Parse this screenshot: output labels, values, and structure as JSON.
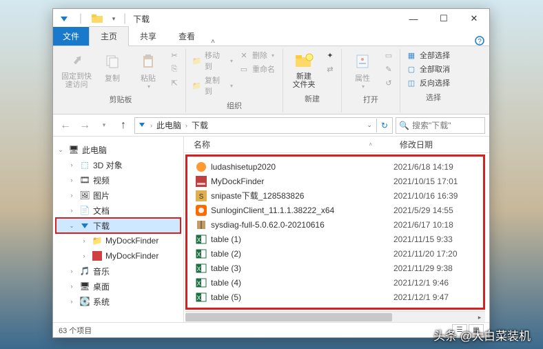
{
  "window": {
    "title": "下载",
    "min": "—",
    "max": "☐",
    "close": "✕"
  },
  "ribbonTabs": {
    "file": "文件",
    "home": "主页",
    "share": "共享",
    "view": "查看"
  },
  "ribbon": {
    "pin": "固定到快\n速访问",
    "copy": "复制",
    "paste": "粘贴",
    "clipboard_actions": {
      "cut": "",
      "copypath": "",
      "pasteshortcut": ""
    },
    "group_clipboard": "剪贴板",
    "moveto": "移动到",
    "copyto": "复制到",
    "delete": "删除",
    "rename": "重命名",
    "group_organize": "组织",
    "newfolder": "新建\n文件夹",
    "group_new": "新建",
    "properties": "属性",
    "group_open": "打开",
    "selectall": "全部选择",
    "selectnone": "全部取消",
    "invertsel": "反向选择",
    "group_select": "选择"
  },
  "address": {
    "pc": "此电脑",
    "folder": "下载",
    "search_placeholder": "搜索\"下载\""
  },
  "tree": {
    "thispc": "此电脑",
    "objects3d": "3D 对象",
    "videos": "视频",
    "pictures": "图片",
    "documents": "文档",
    "downloads": "下载",
    "mydock1": "MyDockFinder",
    "mydock2": "MyDockFinder",
    "music": "音乐",
    "desktop": "桌面",
    "system": "系统"
  },
  "columns": {
    "name": "名称",
    "date": "修改日期"
  },
  "files": [
    {
      "icon": "orange-setup",
      "name": "ludashisetup2020",
      "date": "2021/6/18 14:19"
    },
    {
      "icon": "dock",
      "name": "MyDockFinder",
      "date": "2021/10/15 17:01"
    },
    {
      "icon": "snipaste",
      "name": "snipaste下载_128583826",
      "date": "2021/10/16 16:39"
    },
    {
      "icon": "sunlogin",
      "name": "SunloginClient_11.1.1.38222_x64",
      "date": "2021/5/29 14:55"
    },
    {
      "icon": "zip",
      "name": "sysdiag-full-5.0.62.0-20210616",
      "date": "2021/6/17 10:18"
    },
    {
      "icon": "excel",
      "name": "table (1)",
      "date": "2021/11/15 9:33"
    },
    {
      "icon": "excel",
      "name": "table (2)",
      "date": "2021/11/20 17:20"
    },
    {
      "icon": "excel",
      "name": "table (3)",
      "date": "2021/11/29 9:38"
    },
    {
      "icon": "excel",
      "name": "table (4)",
      "date": "2021/12/1 9:46"
    },
    {
      "icon": "excel",
      "name": "table (5)",
      "date": "2021/12/1 9:47"
    }
  ],
  "status": {
    "count": "63 个项目"
  },
  "watermark": "头条 @大白菜装机"
}
